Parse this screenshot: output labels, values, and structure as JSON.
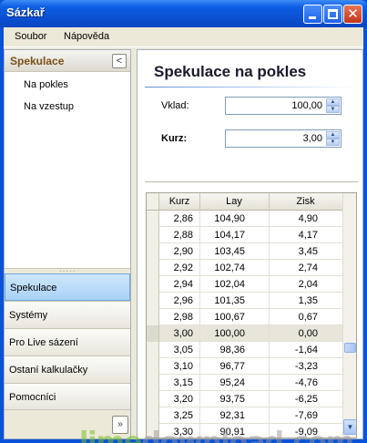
{
  "window": {
    "title": "Sázkař",
    "close_glyph": "✕"
  },
  "menu": {
    "items": [
      "Soubor",
      "Nápověda"
    ]
  },
  "left_pane": {
    "header": "Spekulace",
    "collapse_glyph": "<",
    "links": [
      "Na pokles",
      "Na vzestup"
    ],
    "splitter_dots": "·····",
    "nav_buttons": [
      "Spekulace",
      "Systémy",
      "Pro Live sázení",
      "Ostaní kalkulačky",
      "Pomocníci"
    ],
    "active_nav": "Spekulace",
    "more_glyph": "»"
  },
  "main": {
    "title": "Spekulace na pokles",
    "fields": [
      {
        "label": "Vklad:",
        "value": "100,00",
        "bold": false
      },
      {
        "label": "Kurz:",
        "value": "3,00",
        "bold": true
      }
    ],
    "spin_up_glyph": "▲",
    "spin_down_glyph": "▼",
    "table": {
      "columns": [
        "Kurz",
        "Lay",
        "Zisk"
      ],
      "rows": [
        [
          "2,86",
          "104,90",
          "4,90"
        ],
        [
          "2,88",
          "104,17",
          "4,17"
        ],
        [
          "2,90",
          "103,45",
          "3,45"
        ],
        [
          "2,92",
          "102,74",
          "2,74"
        ],
        [
          "2,94",
          "102,04",
          "2,04"
        ],
        [
          "2,96",
          "101,35",
          "1,35"
        ],
        [
          "2,98",
          "100,67",
          "0,67"
        ],
        [
          "3,00",
          "100,00",
          "0,00"
        ],
        [
          "3,05",
          "98,36",
          "-1,64"
        ],
        [
          "3,10",
          "96,77",
          "-3,23"
        ],
        [
          "3,15",
          "95,24",
          "-4,76"
        ],
        [
          "3,20",
          "93,75",
          "-6,25"
        ],
        [
          "3,25",
          "92,31",
          "-7,69"
        ],
        [
          "3,30",
          "90,91",
          "-9,09"
        ]
      ],
      "selected_row": 7,
      "scroll_down_glyph": "▼"
    }
  },
  "watermark": {
    "part1": "lime",
    "part2": "download.com"
  }
}
